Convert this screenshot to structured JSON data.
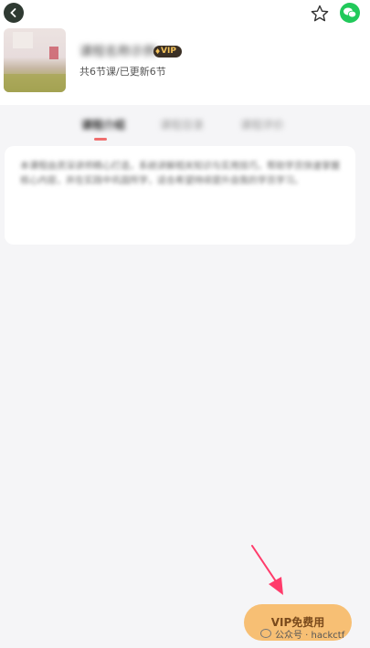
{
  "header": {
    "back_icon": "back-arrow-icon",
    "favorite_icon": "star-icon",
    "share_icon": "wechat-icon"
  },
  "course": {
    "title": "课程名称示例",
    "vip_badge": "VIP",
    "lesson_count": "共6节课/已更新6节"
  },
  "tabs": [
    {
      "label": "课程介绍"
    },
    {
      "label": "课程目录"
    },
    {
      "label": "课程评价"
    }
  ],
  "intro": {
    "text": "本课程由资深讲师精心打造，系统讲解相关知识与实用技巧，帮助学员快速掌握核心内容，并在实践中巩固所学，适合希望持续提升自我的学员学习。"
  },
  "cta": {
    "label": "VIP免费用"
  },
  "watermark": {
    "text": "公众号 · hackctf"
  },
  "colors": {
    "cta_bg": "#f7bf74",
    "tab_accent": "#ef6e6e",
    "annotation_arrow": "#ff3b6b"
  }
}
